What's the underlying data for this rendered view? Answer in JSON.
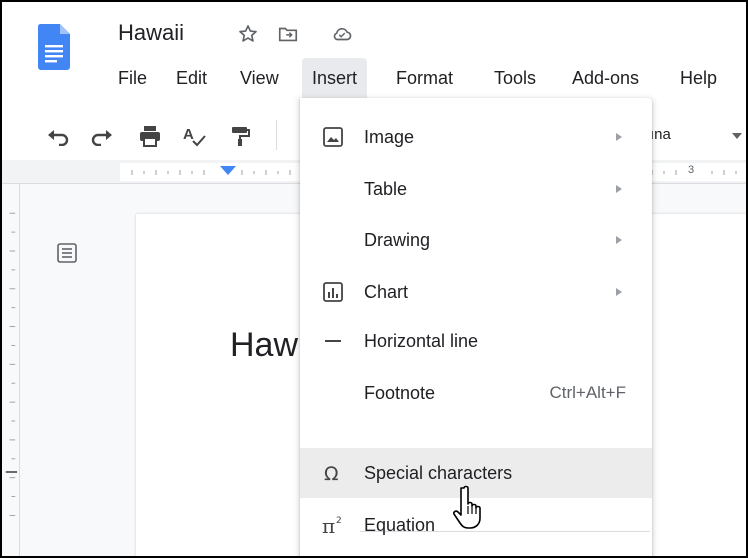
{
  "document": {
    "title": "Hawaii",
    "heading_fragment": "Haw"
  },
  "menubar": {
    "items": [
      {
        "label": "File"
      },
      {
        "label": "Edit"
      },
      {
        "label": "View"
      },
      {
        "label": "Insert",
        "active": true
      },
      {
        "label": "Format"
      },
      {
        "label": "Tools"
      },
      {
        "label": "Add-ons"
      },
      {
        "label": "Help"
      }
    ]
  },
  "toolbar": {
    "icons": [
      "undo-icon",
      "redo-icon",
      "print-icon",
      "spellcheck-icon",
      "paint-format-icon"
    ],
    "font_fragment": "ına"
  },
  "ruler": {
    "visible_number": "3"
  },
  "insert_menu": {
    "items": [
      {
        "label": "Image",
        "icon": "image-icon",
        "submenu": true
      },
      {
        "label": "Table",
        "icon": "",
        "submenu": true
      },
      {
        "label": "Drawing",
        "icon": "",
        "submenu": true
      },
      {
        "label": "Chart",
        "icon": "chart-icon",
        "submenu": true
      },
      {
        "label": "Horizontal line",
        "icon": "horizontal-line-icon",
        "submenu": false
      },
      {
        "label": "Footnote",
        "icon": "",
        "shortcut": "Ctrl+Alt+F",
        "submenu": false
      },
      {
        "label": "Special characters",
        "icon": "omega-icon",
        "submenu": false,
        "hovered": true
      },
      {
        "label": "Equation",
        "icon": "pi-squared-icon",
        "submenu": false
      }
    ]
  },
  "colors": {
    "docs_blue": "#4285f4",
    "menu_hover": "#ececec",
    "active_menu_bg": "#e8eaed",
    "text": "#202124",
    "secondary_text": "#5f6368"
  }
}
